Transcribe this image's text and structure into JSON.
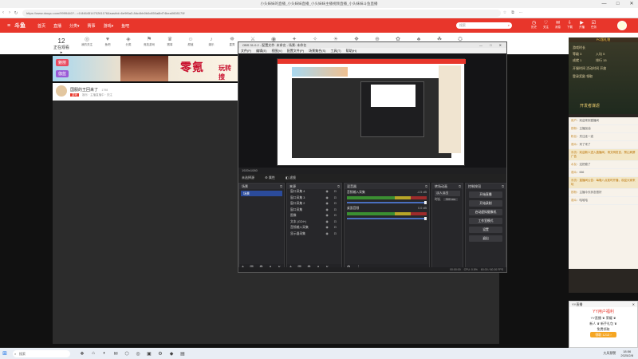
{
  "window": {
    "title": "小头妹妹的直播_小头妹妹直播_小头妹妹主播视频直播_小头妹妹斗鱼直播",
    "controls": [
      "—",
      "□",
      "✕"
    ]
  },
  "browser": {
    "url": "https://www.douyu.com/9999440?...=0.846451470261176&sashid=6e9f6a3-8dc4bb0b0c850a8bf74bea0608170f",
    "nav_back": "‹",
    "nav_forward": "›",
    "nav_reload": "↻",
    "tools": [
      "☆",
      "⧉",
      "⋯"
    ]
  },
  "header": {
    "logo": "斗鱼",
    "nav": [
      "首页",
      "直播",
      "分类▾",
      "赛事",
      "游戏▾",
      "鱼吧"
    ],
    "search_placeholder": "搜索",
    "icons": [
      {
        "name": "history-icon",
        "glyph": "◷",
        "label": "历史"
      },
      {
        "name": "follow-icon",
        "glyph": "♡",
        "label": "关注"
      },
      {
        "name": "message-icon",
        "glyph": "✉",
        "label": "消息"
      },
      {
        "name": "download-icon",
        "glyph": "⇩",
        "label": "下载"
      },
      {
        "name": "live-start-icon",
        "glyph": "▶",
        "label": "开播"
      },
      {
        "name": "task-icon",
        "glyph": "☑",
        "label": "任务"
      }
    ]
  },
  "categories": {
    "follow_count": "12",
    "follow_label": "正在观看 ▸",
    "items": [
      {
        "icon": "◎",
        "label": "我的关注"
      },
      {
        "icon": "♥",
        "label": "鱼吧"
      },
      {
        "icon": "◈",
        "label": "分类"
      },
      {
        "icon": "⚑",
        "label": "竞技游戏"
      },
      {
        "icon": "♛",
        "label": "赛事"
      },
      {
        "icon": "☺",
        "label": "颜值"
      },
      {
        "icon": "♪",
        "label": "娱乐"
      },
      {
        "icon": "⛯",
        "label": "星秀"
      },
      {
        "icon": "⚔",
        "label": "网游竞技"
      },
      {
        "icon": "◉",
        "label": "手游"
      },
      {
        "icon": "✦",
        "label": "户外"
      },
      {
        "icon": "✧",
        "label": "科技"
      },
      {
        "icon": "☀",
        "label": "二次元"
      },
      {
        "icon": "❖",
        "label": "体育"
      },
      {
        "icon": "⊕",
        "label": "派对"
      },
      {
        "icon": "✿",
        "label": "鱼乐"
      },
      {
        "icon": "♣",
        "label": "棋牌"
      },
      {
        "icon": "☘",
        "label": "综合"
      },
      {
        "icon": "⛭",
        "label": "更多"
      }
    ]
  },
  "banner": {
    "title": "零氪",
    "subtitle": "玩转 搜",
    "badge_top": "魅丽",
    "badge_bottom": "伽蓝"
  },
  "streamer": {
    "name": "国服的王回来了",
    "level": "1798",
    "tag": "游戏",
    "sub": "娱乐 · 主播直播中 · 关注"
  },
  "right_panel": {
    "top": "PC版礼物",
    "game_lines": [
      "游戏时长",
      "等级 3",
      "入坑 5",
      "成就 1",
      "排行 15",
      "开服时间 活动时间 开放",
      "登录奖励 领取"
    ],
    "game_caption": "开发者谋虐",
    "chat": [
      {
        "user": "用户",
        "text": "欢迎来到直播间"
      },
      {
        "user": "铁粉",
        "text": "主播加油"
      },
      {
        "user": "粉丝",
        "text": "关注走一波"
      },
      {
        "user": "观众",
        "text": "来了来了"
      },
      {
        "user": "系统",
        "text": "欢迎新人进入直播间，请文明发言，禁止刷屏广告"
      },
      {
        "user": "水友",
        "text": "这把稳了"
      },
      {
        "user": "观众",
        "text": "666"
      },
      {
        "user": "系统",
        "text": "直播间公告：每晚八点准时开播，欢迎大家来玩"
      },
      {
        "user": "铁粉",
        "text": "主播今天状态很好"
      },
      {
        "user": "观众",
        "text": "哈哈哈"
      }
    ]
  },
  "yy_panel": {
    "title": "YY直播",
    "close": "✕",
    "headline": "YY用户福利",
    "line1": "YY直播 ♛ 荣耀 ♛",
    "line2": "新人 ♛ 新手礼包 ♛",
    "line3": "免费领取",
    "button": "领取 1213 ›"
  },
  "obs": {
    "title": "OBS 31.0.2 - 配置文件: 未命名 - 场景: 未命名",
    "window_controls": "— □ ✕",
    "menu": [
      "文件(F)",
      "编辑(E)",
      "视图(V)",
      "配置文件(P)",
      "场景集合(S)",
      "工具(T)",
      "帮助(H)"
    ],
    "preview_label": "未选择源",
    "properties_btn": "⚙ 属性",
    "filters_btn": "◧ 滤镜",
    "scenes_title": "场景",
    "scene_selected": "场景",
    "sources_title": "来源",
    "sources": [
      "窗口采集 4",
      "窗口采集 3",
      "窗口采集 2",
      "窗口采集",
      "图像",
      "文本 (GDI+)",
      "音频输入采集",
      "显示器采集"
    ],
    "mixer_title": "混音器",
    "mixer_channels": [
      {
        "name": "音频输入采集",
        "db": "-4.5 dB"
      },
      {
        "name": "桌面音频",
        "db": "0.0 dB"
      }
    ],
    "transitions_title": "转场动画",
    "transition_type": "淡入淡出",
    "duration_label": "时长",
    "duration_value": "300 ms",
    "controls_title": "控制按钮",
    "controls": [
      "开始直播",
      "开始录制",
      "启动虚拟摄像机",
      "工作室模式",
      "设置",
      "退出"
    ],
    "status_cpu": "CPU: 0.5%",
    "status_fps": "60.00 / 60.00 FPS",
    "status_time": "00:00:00",
    "scene_foot": "+ ▥ ⚙ ∧ ∨",
    "source_foot": "+ ▥ ⚙ ∧ ∨",
    "mixer_foot": "⚙ ⋮"
  },
  "taskbar": {
    "search": "搜索",
    "apps": [
      "❖",
      "⌂",
      "◐",
      "✉",
      "⬡",
      "◎",
      "▣",
      "⚙",
      "◆",
      "▤"
    ],
    "tray_text": "大风预警",
    "time": "18:56",
    "date": "2025/2/8"
  }
}
